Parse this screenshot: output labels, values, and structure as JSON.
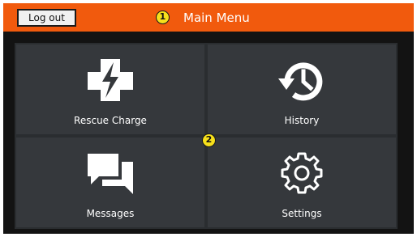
{
  "topbar": {
    "logout_label": "Log out",
    "title": "Main Menu",
    "callout": "1",
    "color": "#f15a0d"
  },
  "menu": {
    "callout": "2",
    "tiles": [
      {
        "label": "Rescue Charge",
        "icon": "rescue-charge-icon"
      },
      {
        "label": "History",
        "icon": "history-icon"
      },
      {
        "label": "Messages",
        "icon": "messages-icon"
      },
      {
        "label": "Settings",
        "icon": "gear-icon"
      }
    ]
  }
}
